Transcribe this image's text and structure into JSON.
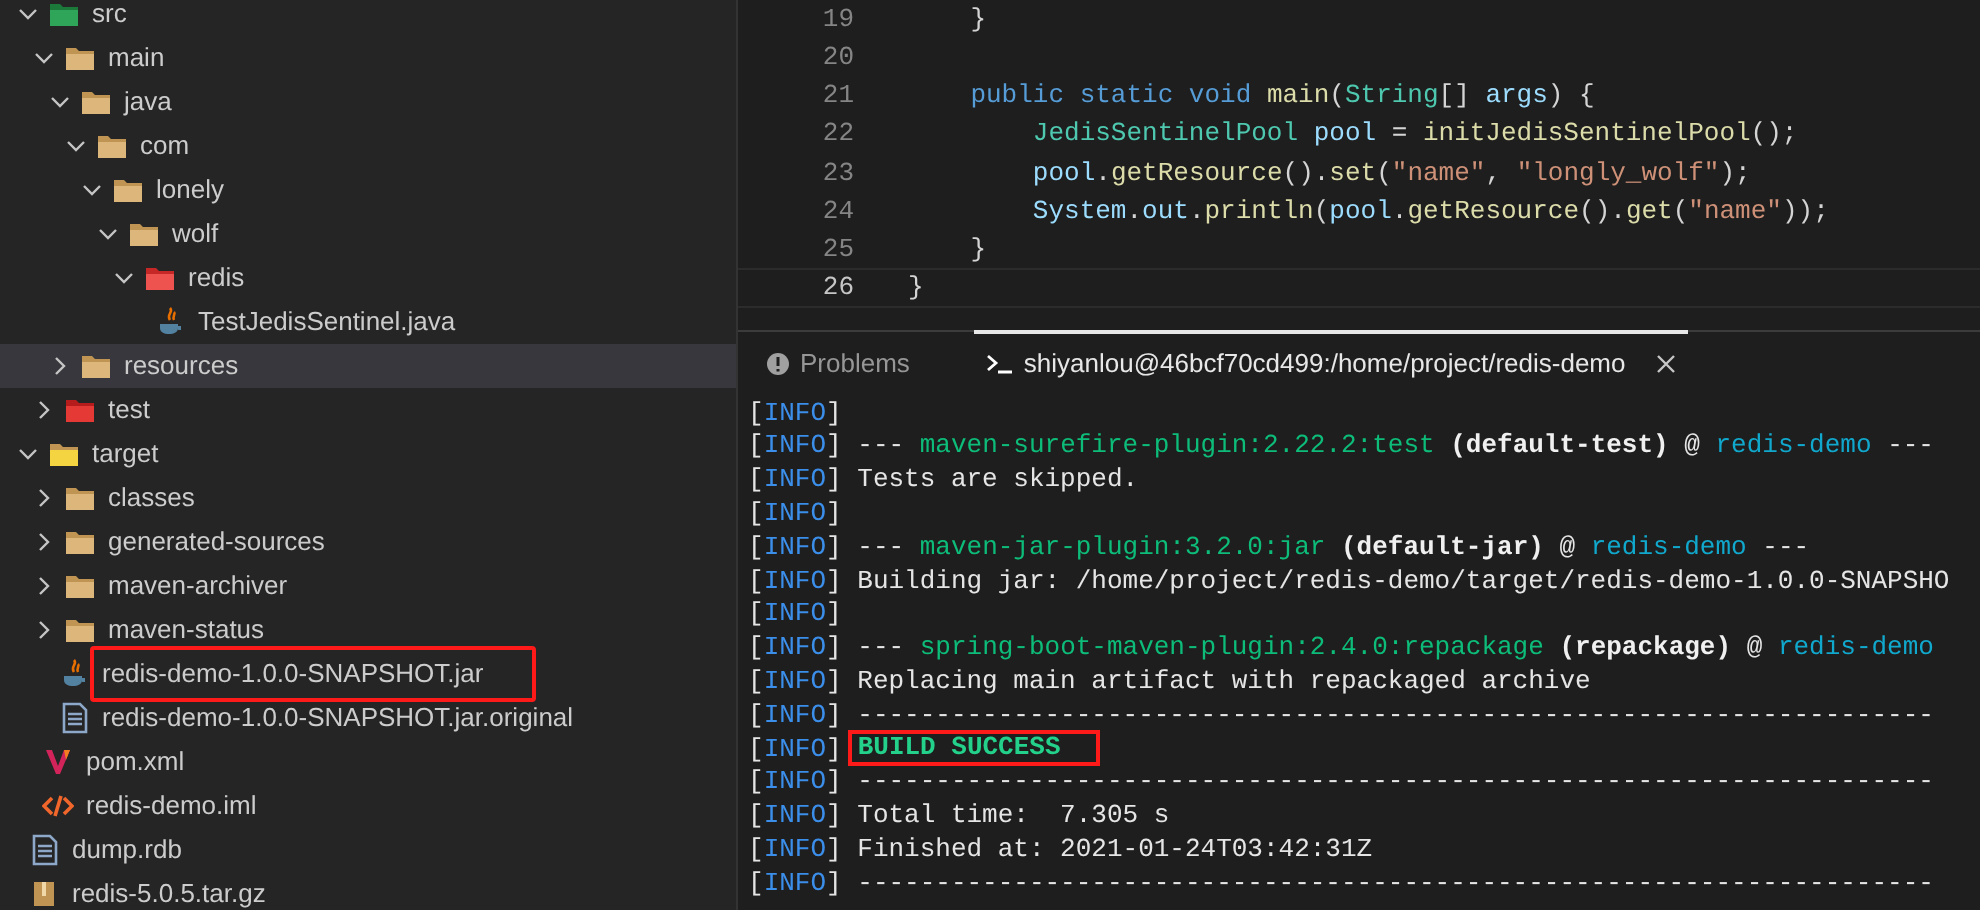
{
  "explorer": {
    "tree": [
      {
        "children": [
          {
            "label": "src",
            "kind": "folder-src",
            "expanded": true,
            "selected": false,
            "children": [
              {
                "label": "main",
                "kind": "folder",
                "expanded": true,
                "selected": false,
                "children": [
                  {
                    "label": "java",
                    "kind": "folder",
                    "expanded": true,
                    "selected": false,
                    "children": [
                      {
                        "label": "com",
                        "kind": "folder",
                        "expanded": true,
                        "selected": false,
                        "children": [
                          {
                            "label": "lonely",
                            "kind": "folder",
                            "expanded": true,
                            "selected": false,
                            "children": [
                              {
                                "label": "wolf",
                                "kind": "folder",
                                "expanded": true,
                                "selected": false,
                                "children": [
                                  {
                                    "label": "redis",
                                    "kind": "folder-redis",
                                    "expanded": true,
                                    "selected": false,
                                    "children": [
                                      {
                                        "label": "TestJedisSentinel.java",
                                        "kind": "java",
                                        "selected": false,
                                        "boxed": false
                                      }
                                    ]
                                  }
                                ]
                              }
                            ]
                          }
                        ]
                      }
                    ]
                  },
                  {
                    "label": "resources",
                    "kind": "folder",
                    "expanded": false,
                    "selected": true
                  }
                ]
              },
              {
                "label": "test",
                "kind": "folder-test",
                "expanded": false,
                "selected": false
              }
            ]
          },
          {
            "label": "target",
            "kind": "folder-target",
            "expanded": true,
            "selected": false,
            "children": [
              {
                "label": "classes",
                "kind": "folder",
                "expanded": false,
                "selected": false
              },
              {
                "label": "generated-sources",
                "kind": "folder",
                "expanded": false,
                "selected": false
              },
              {
                "label": "maven-archiver",
                "kind": "folder",
                "expanded": false,
                "selected": false
              },
              {
                "label": "maven-status",
                "kind": "folder",
                "expanded": false,
                "selected": false
              },
              {
                "label": "redis-demo-1.0.0-SNAPSHOT.jar",
                "kind": "java",
                "selected": false,
                "boxed": true
              },
              {
                "label": "redis-demo-1.0.0-SNAPSHOT.jar.original",
                "kind": "file",
                "selected": false,
                "boxed": false
              }
            ]
          },
          {
            "label": "pom.xml",
            "kind": "maven",
            "selected": false,
            "boxed": false
          },
          {
            "label": "redis-demo.iml",
            "kind": "xml",
            "selected": false,
            "boxed": false
          }
        ]
      },
      {
        "label": "dump.rdb",
        "kind": "file",
        "selected": false,
        "boxed": false
      },
      {
        "label": "redis-5.0.5.tar.gz",
        "kind": "archive",
        "selected": false,
        "boxed": false
      }
    ]
  },
  "editor": {
    "lines": [
      {
        "number": "19",
        "current": false,
        "tokens": [
          {
            "text": "    }",
            "kind": "plain"
          }
        ]
      },
      {
        "number": "20",
        "current": false
      },
      {
        "number": "21",
        "current": false,
        "tokens": [
          {
            "text": "    public static void ",
            "kind": "keyword"
          },
          {
            "text": "main",
            "kind": "function"
          },
          {
            "text": "(",
            "kind": "plain"
          },
          {
            "text": "String",
            "kind": "type"
          },
          {
            "text": "[] ",
            "kind": "plain"
          },
          {
            "text": "args",
            "kind": "variable"
          },
          {
            "text": ") {",
            "kind": "plain"
          }
        ]
      },
      {
        "number": "22",
        "current": false,
        "tokens": [
          {
            "text": "        JedisSentinelPool",
            "kind": "type"
          },
          {
            "text": " pool",
            "kind": "variable"
          },
          {
            "text": " = ",
            "kind": "plain"
          },
          {
            "text": "initJedisSentinelPool",
            "kind": "function"
          },
          {
            "text": "();",
            "kind": "plain"
          }
        ]
      },
      {
        "number": "23",
        "current": false,
        "tokens": [
          {
            "text": "        pool",
            "kind": "variable"
          },
          {
            "text": ".",
            "kind": "plain"
          },
          {
            "text": "getResource",
            "kind": "function"
          },
          {
            "text": "().",
            "kind": "plain"
          },
          {
            "text": "set",
            "kind": "function"
          },
          {
            "text": "(",
            "kind": "plain"
          },
          {
            "text": "\"name\"",
            "kind": "string"
          },
          {
            "text": ", ",
            "kind": "plain"
          },
          {
            "text": "\"longly_wolf\"",
            "kind": "string"
          },
          {
            "text": ");",
            "kind": "plain"
          }
        ]
      },
      {
        "number": "24",
        "current": false,
        "tokens": [
          {
            "text": "        System",
            "kind": "variable"
          },
          {
            "text": ".",
            "kind": "plain"
          },
          {
            "text": "out",
            "kind": "variable"
          },
          {
            "text": ".",
            "kind": "plain"
          },
          {
            "text": "println",
            "kind": "function"
          },
          {
            "text": "(",
            "kind": "plain"
          },
          {
            "text": "pool",
            "kind": "variable"
          },
          {
            "text": ".",
            "kind": "plain"
          },
          {
            "text": "getResource",
            "kind": "function"
          },
          {
            "text": "().",
            "kind": "plain"
          },
          {
            "text": "get",
            "kind": "function"
          },
          {
            "text": "(",
            "kind": "plain"
          },
          {
            "text": "\"name\"",
            "kind": "string"
          },
          {
            "text": "));",
            "kind": "plain"
          }
        ]
      },
      {
        "number": "25",
        "current": false,
        "tokens": [
          {
            "text": "    }",
            "kind": "plain"
          }
        ]
      },
      {
        "number": "26",
        "current": true,
        "tokens": [
          {
            "text": "}",
            "kind": "plain"
          }
        ]
      }
    ]
  },
  "panel": {
    "tabs": [
      {
        "label": "Problems",
        "kind": "problems",
        "selected": false,
        "closable": false
      },
      {
        "label": "shiyanlou@46bcf70cd499:/home/project/redis-demo",
        "kind": "terminal",
        "selected": true,
        "closable": true
      }
    ],
    "terminal": [
      {
        "tag": "[INFO]"
      },
      {
        "tag": "[INFO]",
        "segments": [
          {
            "text": " --- ",
            "kind": "plain"
          },
          {
            "text": "maven-surefire-plugin:2.22.2:test",
            "kind": "plugin"
          },
          {
            "text": " (default-test)",
            "kind": "bold"
          },
          {
            "text": " @ ",
            "kind": "plain"
          },
          {
            "text": "redis-demo",
            "kind": "project"
          },
          {
            "text": " ---",
            "kind": "plain"
          }
        ]
      },
      {
        "tag": "[INFO]",
        "segments": [
          {
            "text": " Tests are skipped.",
            "kind": "plain"
          }
        ]
      },
      {
        "tag": "[INFO]"
      },
      {
        "tag": "[INFO]",
        "segments": [
          {
            "text": " --- ",
            "kind": "plain"
          },
          {
            "text": "maven-jar-plugin:3.2.0:jar",
            "kind": "plugin"
          },
          {
            "text": " (default-jar)",
            "kind": "bold"
          },
          {
            "text": " @ ",
            "kind": "plain"
          },
          {
            "text": "redis-demo",
            "kind": "project"
          },
          {
            "text": " ---",
            "kind": "plain"
          }
        ]
      },
      {
        "tag": "[INFO]",
        "segments": [
          {
            "text": " Building jar: /home/project/redis-demo/target/redis-demo-1.0.0-SNAPSHO",
            "kind": "plain"
          }
        ]
      },
      {
        "tag": "[INFO]"
      },
      {
        "tag": "[INFO]",
        "segments": [
          {
            "text": " --- ",
            "kind": "plain"
          },
          {
            "text": "spring-boot-maven-plugin:2.4.0:repackage",
            "kind": "plugin"
          },
          {
            "text": " (repackage)",
            "kind": "bold"
          },
          {
            "text": " @ ",
            "kind": "plain"
          },
          {
            "text": "redis-demo",
            "kind": "project"
          }
        ]
      },
      {
        "tag": "[INFO]",
        "segments": [
          {
            "text": " Replacing main artifact with repackaged archive",
            "kind": "plain"
          }
        ]
      },
      {
        "tag": "[INFO]",
        "segments": [
          {
            "text": " ---------------------------------------------------------------------",
            "kind": "plain"
          }
        ]
      },
      {
        "tag": "[INFO]",
        "segments": [
          {
            "text": "BUILD SUCCESS",
            "kind": "success",
            "boxed": true
          }
        ]
      },
      {
        "tag": "[INFO]",
        "segments": [
          {
            "text": " ---------------------------------------------------------------------",
            "kind": "plain"
          }
        ]
      },
      {
        "tag": "[INFO]",
        "segments": [
          {
            "text": " Total time:  7.305 s",
            "kind": "plain"
          }
        ]
      },
      {
        "tag": "[INFO]",
        "segments": [
          {
            "text": " Finished at: 2021-01-24T03:42:31Z",
            "kind": "plain"
          }
        ]
      },
      {
        "tag": "[INFO]",
        "segments": [
          {
            "text": " ---------------------------------------------------------------------",
            "kind": "plain"
          }
        ]
      }
    ]
  }
}
